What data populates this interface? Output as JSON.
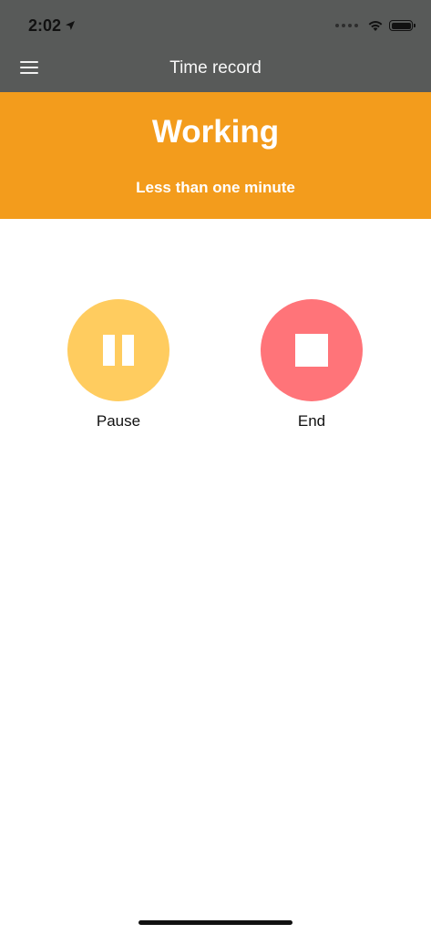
{
  "status_bar": {
    "time": "2:02",
    "icons": [
      "location-arrow-icon",
      "signal-dots-icon",
      "wifi-icon",
      "battery-icon"
    ]
  },
  "nav": {
    "title": "Time record",
    "menu_icon": "hamburger-menu-icon"
  },
  "status_banner": {
    "title": "Working",
    "subtitle": "Less than one minute",
    "color": "#f39c1c"
  },
  "actions": {
    "pause": {
      "label": "Pause",
      "icon": "pause-icon",
      "color": "#ffcc5f"
    },
    "end": {
      "label": "End",
      "icon": "stop-icon",
      "color": "#ff7479"
    }
  },
  "colors": {
    "header_bg": "#585a59",
    "banner_bg": "#f39c1c",
    "pause_bg": "#ffcc5f",
    "end_bg": "#ff7479"
  }
}
